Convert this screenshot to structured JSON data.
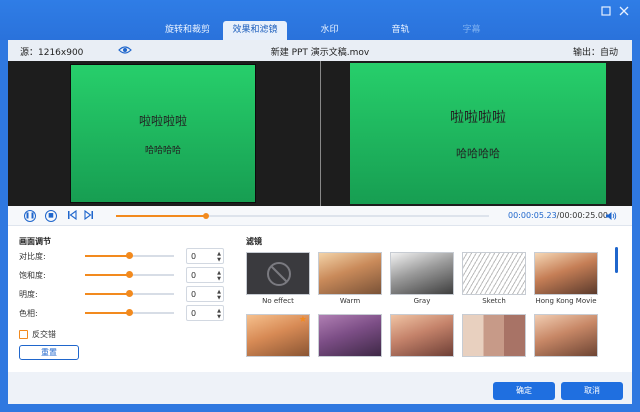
{
  "tabs": [
    {
      "label": "旋转和裁剪"
    },
    {
      "label": "效果和滤镜"
    },
    {
      "label": "水印"
    },
    {
      "label": "音轨"
    },
    {
      "label": "字幕"
    }
  ],
  "info": {
    "source": "源：1216x900",
    "file_name": "新建 PPT 演示文稿.mov",
    "output": "输出：自动"
  },
  "preview": {
    "line1": "啦啦啦啦",
    "line2": "哈哈哈哈"
  },
  "player": {
    "current_time": "00:00:05.23",
    "total_time": "/00:00:25.00",
    "progress": 0.24
  },
  "adjust": {
    "title": "画面调节",
    "rows": [
      {
        "label": "对比度:",
        "value": "0",
        "level": 0.5
      },
      {
        "label": "饱和度:",
        "value": "0",
        "level": 0.5
      },
      {
        "label": "明度:",
        "value": "0",
        "level": 0.5
      },
      {
        "label": "色相:",
        "value": "0",
        "level": 0.5
      }
    ],
    "checkbox_label": "反交错",
    "reset_label": "重置"
  },
  "filters": {
    "title": "滤镜",
    "items": [
      {
        "label": "No effect"
      },
      {
        "label": "Warm"
      },
      {
        "label": "Gray"
      },
      {
        "label": "Sketch"
      },
      {
        "label": "Hong Kong Movie"
      },
      {
        "label": ""
      },
      {
        "label": ""
      },
      {
        "label": ""
      },
      {
        "label": ""
      },
      {
        "label": ""
      }
    ]
  },
  "footer": {
    "confirm_label": "确定",
    "cancel_label": "取消"
  },
  "colors": {
    "accent": "#1f6fe0",
    "slider": "#f28a1e",
    "preview_green": "#22c563"
  }
}
